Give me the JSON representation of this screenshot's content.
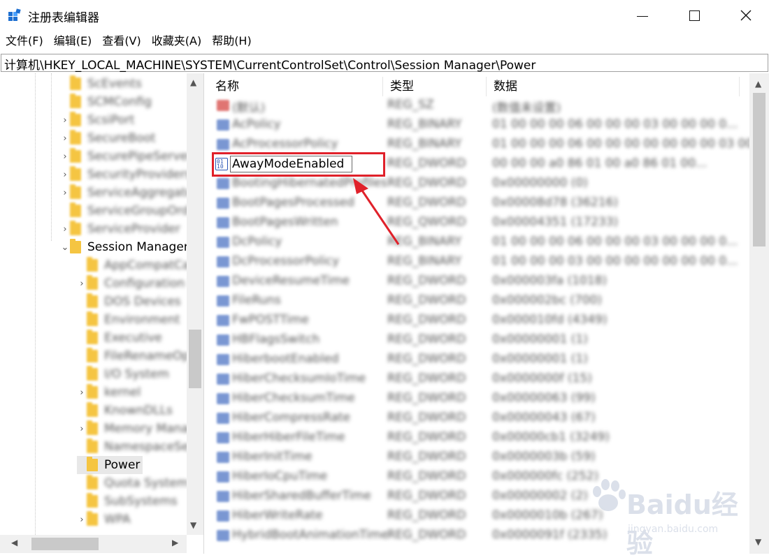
{
  "window": {
    "title": "注册表编辑器",
    "minimize_label": "–",
    "close_label": "✕"
  },
  "menu": [
    "文件(F)",
    "编辑(E)",
    "查看(V)",
    "收藏夹(A)",
    "帮助(H)"
  ],
  "address": "计算机\\HKEY_LOCAL_MACHINE\\SYSTEM\\CurrentControlSet\\Control\\Session Manager\\Power",
  "tree": {
    "items": [
      {
        "label": "ScEvents",
        "level": 1,
        "expand": ""
      },
      {
        "label": "SCMConfig",
        "level": 1,
        "expand": ""
      },
      {
        "label": "ScsiPort",
        "level": 1,
        "expand": "›"
      },
      {
        "label": "SecureBoot",
        "level": 1,
        "expand": "›"
      },
      {
        "label": "SecurePipeServers",
        "level": 1,
        "expand": "›"
      },
      {
        "label": "SecurityProviders",
        "level": 1,
        "expand": "›"
      },
      {
        "label": "ServiceAggregatedEvents",
        "level": 1,
        "expand": "›"
      },
      {
        "label": "ServiceGroupOrder",
        "level": 1,
        "expand": ""
      },
      {
        "label": "ServiceProvider",
        "level": 1,
        "expand": "›"
      },
      {
        "label": "Session Manager",
        "level": 1,
        "expand": "⌄"
      },
      {
        "label": "AppCompatCache",
        "level": 2,
        "expand": ""
      },
      {
        "label": "Configuration Manager",
        "level": 2,
        "expand": "›"
      },
      {
        "label": "DOS Devices",
        "level": 2,
        "expand": ""
      },
      {
        "label": "Environment",
        "level": 2,
        "expand": ""
      },
      {
        "label": "Executive",
        "level": 2,
        "expand": ""
      },
      {
        "label": "FileRenameOperations",
        "level": 2,
        "expand": ""
      },
      {
        "label": "I/O System",
        "level": 2,
        "expand": ""
      },
      {
        "label": "kernel",
        "level": 2,
        "expand": "›"
      },
      {
        "label": "KnownDLLs",
        "level": 2,
        "expand": ""
      },
      {
        "label": "Memory Management",
        "level": 2,
        "expand": "›"
      },
      {
        "label": "NamespaceSeparation",
        "level": 2,
        "expand": ""
      },
      {
        "label": "Power",
        "level": 2,
        "expand": ""
      },
      {
        "label": "Quota System",
        "level": 2,
        "expand": ""
      },
      {
        "label": "SubSystems",
        "level": 2,
        "expand": ""
      },
      {
        "label": "WPA",
        "level": 2,
        "expand": "›"
      }
    ]
  },
  "columns": {
    "name": "名称",
    "type": "类型",
    "data": "数据"
  },
  "values": [
    {
      "name": "(默认)",
      "type": "REG_SZ",
      "data": "(数值未设置)",
      "icon": "sz"
    },
    {
      "name": "AcPolicy",
      "type": "REG_BINARY",
      "data": "01 00 00 00 06 00 00 00 03 00 00 00 0...",
      "icon": "bin"
    },
    {
      "name": "AcProcessorPolicy",
      "type": "REG_BINARY",
      "data": "01 00 00 00 06 00 00 00 00 00 00 00 03 00 00 00",
      "icon": "bin"
    },
    {
      "name": "AwayModeEnabled",
      "type": "REG_DWORD",
      "data": "00 00 00 a0 86 01 00 a0 86 01 00...",
      "icon": "edit"
    },
    {
      "name": "BootingHibernatedProfiles",
      "type": "REG_DWORD",
      "data": "0x00000000 (0)",
      "icon": "bin"
    },
    {
      "name": "BootPagesProcessed",
      "type": "REG_DWORD",
      "data": "0x00008d78 (36216)",
      "icon": "bin"
    },
    {
      "name": "BootPagesWritten",
      "type": "REG_QWORD",
      "data": "0x00004351 (17233)",
      "icon": "bin"
    },
    {
      "name": "DcPolicy",
      "type": "REG_BINARY",
      "data": "01 00 00 00 06 00 00 00 03 00 00 00 0...",
      "icon": "bin"
    },
    {
      "name": "DcProcessorPolicy",
      "type": "REG_BINARY",
      "data": "01 00 00 00 03 00 00 00 00 00 00 00 0...",
      "icon": "bin"
    },
    {
      "name": "DeviceResumeTime",
      "type": "REG_DWORD",
      "data": "0x000003fa (1018)",
      "icon": "bin"
    },
    {
      "name": "FileRuns",
      "type": "REG_DWORD",
      "data": "0x000002bc (700)",
      "icon": "bin"
    },
    {
      "name": "FwPOSTTime",
      "type": "REG_DWORD",
      "data": "0x000010fd (4349)",
      "icon": "bin"
    },
    {
      "name": "HBFlagsSwitch",
      "type": "REG_DWORD",
      "data": "0x00000001 (1)",
      "icon": "bin"
    },
    {
      "name": "HiberbootEnabled",
      "type": "REG_DWORD",
      "data": "0x00000001 (1)",
      "icon": "bin"
    },
    {
      "name": "HiberChecksumIoTime",
      "type": "REG_DWORD",
      "data": "0x0000000f (15)",
      "icon": "bin"
    },
    {
      "name": "HiberChecksumTime",
      "type": "REG_DWORD",
      "data": "0x00000063 (99)",
      "icon": "bin"
    },
    {
      "name": "HiberCompressRate",
      "type": "REG_DWORD",
      "data": "0x00000043 (67)",
      "icon": "bin"
    },
    {
      "name": "HiberHiberFileTime",
      "type": "REG_DWORD",
      "data": "0x00000cb1 (3249)",
      "icon": "bin"
    },
    {
      "name": "HiberInitTime",
      "type": "REG_DWORD",
      "data": "0x0000003b (59)",
      "icon": "bin"
    },
    {
      "name": "HiberIoCpuTime",
      "type": "REG_DWORD",
      "data": "0x000000fc (252)",
      "icon": "bin"
    },
    {
      "name": "HiberSharedBufferTime",
      "type": "REG_DWORD",
      "data": "0x00000002 (2)",
      "icon": "bin"
    },
    {
      "name": "HiberWriteRate",
      "type": "REG_DWORD",
      "data": "0x0000010b (267)",
      "icon": "bin"
    },
    {
      "name": "HybridBootAnimationTime",
      "type": "REG_DWORD",
      "data": "0x0000091f (2335)",
      "icon": "bin"
    }
  ],
  "rename_value": "AwayModeEnabled",
  "annotation_color": "#e0212a",
  "watermark": {
    "brand": "Baidu",
    "cn": "经验",
    "sub": "jingyan.baidu.com"
  }
}
